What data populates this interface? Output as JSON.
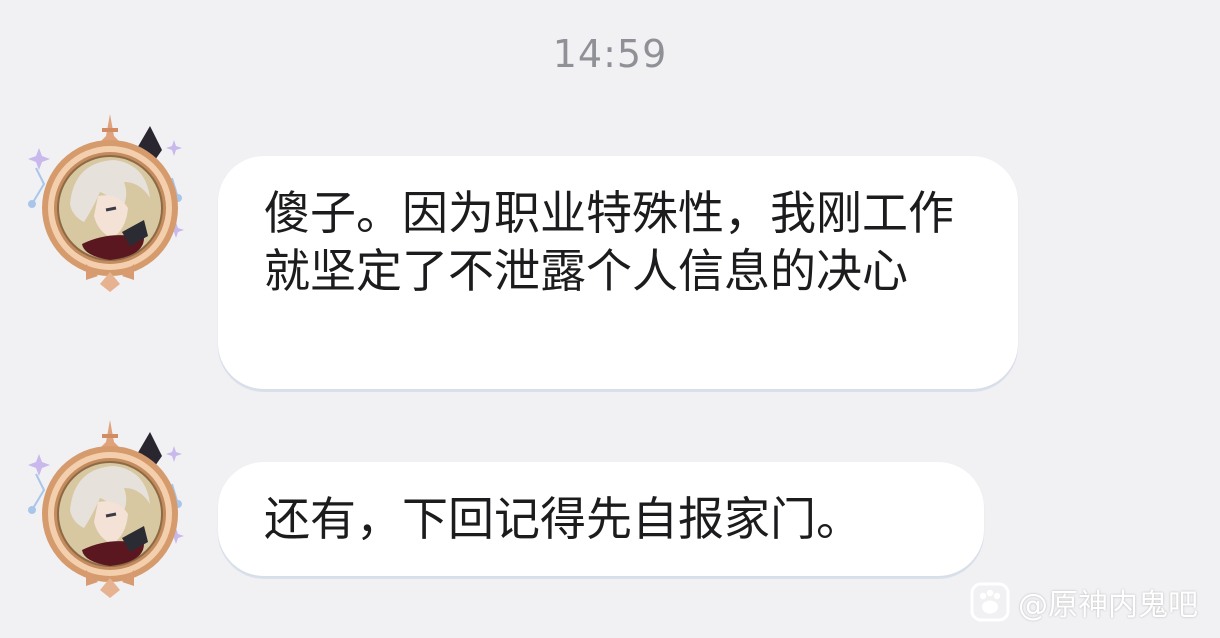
{
  "chat": {
    "timestamp": "14:59",
    "messages": [
      {
        "text": "傻子。因为职业特殊性，我刚工作就坚定了不泄露个人信息的决心"
      },
      {
        "text": "还有，下回记得先自报家门。"
      }
    ]
  },
  "watermark": {
    "text": "@原神内鬼吧",
    "icon": "tieba-paw-icon"
  },
  "avatar": {
    "icon": "character-avatar-icon"
  },
  "colors": {
    "background": "#f1f1f4",
    "bubble": "#ffffff",
    "timestamp": "#8f9196",
    "frame_gold": "#c9905e"
  }
}
